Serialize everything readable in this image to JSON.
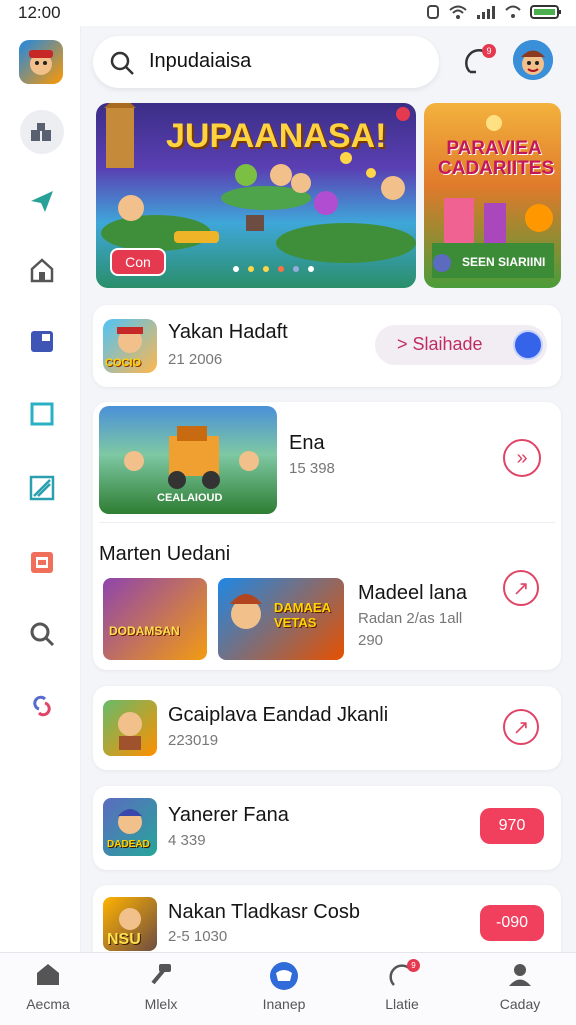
{
  "status_bar": {
    "time": "12:00"
  },
  "search": {
    "value": "Inpudaiaisa"
  },
  "notifications": {
    "badge": "9"
  },
  "banners": [
    {
      "title": "JUPAANASA!",
      "button": "Con"
    },
    {
      "title": "PARAVIEA CADARIITES",
      "caption": "SEEN SIARIINI"
    }
  ],
  "items": [
    {
      "title": "Yakan Hadaft",
      "sub": "21 2006",
      "thumb_text": "COCIO",
      "action_label": "> Slaihade"
    },
    {
      "title": "Ena",
      "sub": "15 398",
      "thumb_text": "CEALAIOUD"
    },
    {
      "section_title": "Marten Uedani",
      "title": "Madeel lana",
      "sub": "Radan 2/as 1all",
      "sub2": "290",
      "thumb1_text": "DODAMSAN",
      "thumb2_text": "DAMAEA VETAS"
    },
    {
      "title": "Gcaiplava Eandad Jkanli",
      "sub": "223019",
      "thumb_text": ""
    },
    {
      "title": "Yanerer Fana",
      "sub": "4 339",
      "thumb_text": "DADEAD",
      "price": "970"
    },
    {
      "title": "Nakan Tladkasr Cosb",
      "sub": "2-5 1030",
      "thumb_text": "NSU",
      "price": "-090"
    }
  ],
  "bottom_nav": [
    {
      "label": "Aecma",
      "icon": "home-icon"
    },
    {
      "label": "Mlelx",
      "icon": "hammer-icon"
    },
    {
      "label": "Inanep",
      "icon": "controller-icon"
    },
    {
      "label": "Llatie",
      "icon": "bell-icon",
      "badge": "9"
    },
    {
      "label": "Caday",
      "icon": "profile-icon"
    }
  ],
  "colors": {
    "accent": "#e04466",
    "pill": "#f0405e",
    "active_tab": "#2f6bd9"
  }
}
